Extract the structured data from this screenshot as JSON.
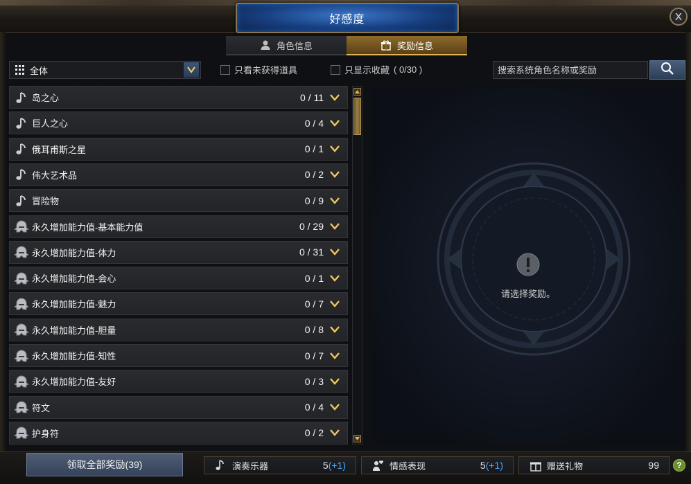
{
  "window": {
    "title": "好感度",
    "close_glyph": "X"
  },
  "tabs": [
    {
      "label": "角色信息",
      "icon": "person-icon",
      "active": false
    },
    {
      "label": "奖励信息",
      "icon": "gift-icon",
      "active": true
    }
  ],
  "filters": {
    "category_selected": "全体",
    "only_unobtained_label": "只看未获得道具",
    "only_favorites_label": "只显示收藏",
    "favorites_count": "( 0/30 )",
    "search_placeholder": "搜索系统角色名称或奖励"
  },
  "rewards": [
    {
      "name": "岛之心",
      "count": "0 / 11",
      "icon": "music-note-icon"
    },
    {
      "name": "巨人之心",
      "count": "0 / 4",
      "icon": "music-note-icon"
    },
    {
      "name": "俄耳甫斯之星",
      "count": "0 / 1",
      "icon": "music-note-icon"
    },
    {
      "name": "伟大艺术品",
      "count": "0 / 2",
      "icon": "music-note-icon"
    },
    {
      "name": "冒险物",
      "count": "0 / 9",
      "icon": "music-note-icon"
    },
    {
      "name": "永久增加能力值-基本能力值",
      "count": "0 / 29",
      "icon": "helmet-icon"
    },
    {
      "name": "永久增加能力值-体力",
      "count": "0 / 31",
      "icon": "helmet-icon"
    },
    {
      "name": "永久增加能力值-会心",
      "count": "0 / 1",
      "icon": "helmet-icon"
    },
    {
      "name": "永久增加能力值-魅力",
      "count": "0 / 7",
      "icon": "helmet-icon"
    },
    {
      "name": "永久增加能力值-胆量",
      "count": "0 / 8",
      "icon": "helmet-icon"
    },
    {
      "name": "永久增加能力值-知性",
      "count": "0 / 7",
      "icon": "helmet-icon"
    },
    {
      "name": "永久增加能力值-友好",
      "count": "0 / 3",
      "icon": "helmet-icon"
    },
    {
      "name": "符文",
      "count": "0 / 4",
      "icon": "helmet-icon"
    },
    {
      "name": "护身符",
      "count": "0 / 2",
      "icon": "helmet-icon"
    }
  ],
  "detail": {
    "empty_message": "请选择奖励。",
    "icon": "exclamation-icon"
  },
  "footer": {
    "claim_all_label": "领取全部奖励(39)",
    "stats": [
      {
        "label": "演奏乐器",
        "value": "5",
        "bonus": "(+1)",
        "icon": "music-note-icon"
      },
      {
        "label": "情感表现",
        "value": "5",
        "bonus": "(+1)",
        "icon": "emote-icon"
      },
      {
        "label": "赠送礼物",
        "value": "99",
        "bonus": "",
        "icon": "gift-icon"
      }
    ],
    "help_glyph": "?"
  },
  "colors": {
    "accent_gold": "#e1b458",
    "plus_blue": "#4aa8ff",
    "active_tab": "#8e6b2c"
  }
}
